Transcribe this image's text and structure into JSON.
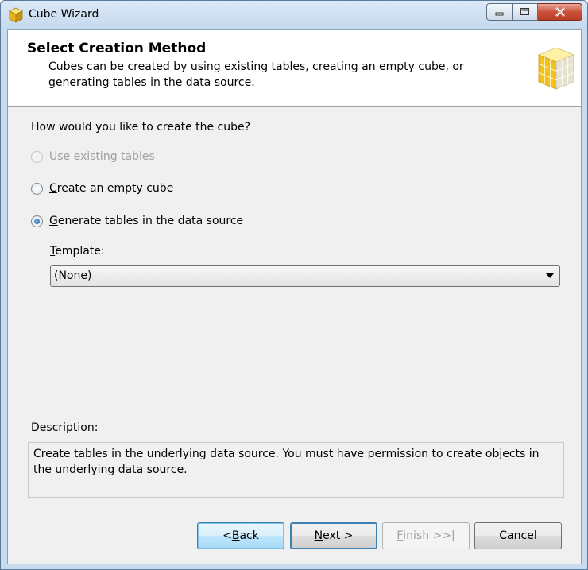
{
  "window": {
    "title": "Cube Wizard"
  },
  "header": {
    "title": "Select Creation Method",
    "description": "Cubes can be created by using existing tables, creating an empty cube, or generating tables in the data source."
  },
  "main": {
    "question": "How would you like to create the cube?",
    "options": [
      {
        "label_rest": "se existing tables",
        "mnemonic": "U",
        "checked": false,
        "enabled": false
      },
      {
        "label_rest": "reate an empty cube",
        "mnemonic": "C",
        "checked": false,
        "enabled": true
      },
      {
        "label_rest": "enerate tables in the data source",
        "mnemonic": "G",
        "checked": true,
        "enabled": true
      }
    ],
    "template": {
      "label_mnemonic": "T",
      "label_rest": "emplate:",
      "selected": "(None)"
    },
    "description_label": "Description:",
    "description_text": "Create tables in the underlying data source. You must have permission to create objects in the underlying data source."
  },
  "footer": {
    "back": {
      "prefix": "< ",
      "mnemonic": "B",
      "rest": "ack"
    },
    "next": {
      "mnemonic": "N",
      "rest": "ext >"
    },
    "finish": {
      "mnemonic": "F",
      "rest": "inish >>|"
    },
    "cancel": "Cancel"
  },
  "colors": {
    "client_bg": "#f0f0f0",
    "header_bg": "#ffffff",
    "cube_yellow": "#f2c21b",
    "close_red": "#c9503a"
  }
}
